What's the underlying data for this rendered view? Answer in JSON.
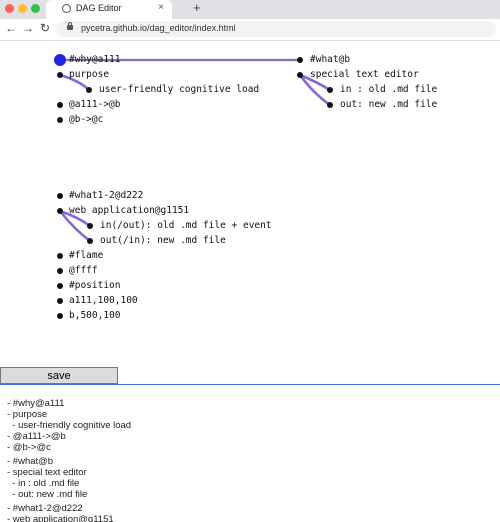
{
  "browser": {
    "tab_title": "DAG Editor",
    "tab_close": "×",
    "new_tab": "+",
    "back": "←",
    "forward": "→",
    "reload": "↻",
    "url": "pycetra.github.io/dag_editor/index.html",
    "traffic_lights": [
      "#ff5f57",
      "#febc2e",
      "#28c840"
    ]
  },
  "graph": {
    "nodes": [
      {
        "text": "#why@a111"
      },
      {
        "text": "purpose"
      },
      {
        "text": "user-friendly cognitive load"
      },
      {
        "text": "@a111->@b"
      },
      {
        "text": "@b->@c"
      },
      {
        "text": "#what@b"
      },
      {
        "text": "special text editor"
      },
      {
        "text": "in : old .md file"
      },
      {
        "text": "out: new .md file"
      },
      {
        "text": "#what1-2@d222"
      },
      {
        "text": "web application@g1151"
      },
      {
        "text": "in(/out): old .md file + event"
      },
      {
        "text": "out(/in): new .md file"
      },
      {
        "text": "#flame"
      },
      {
        "text": "@ffff"
      },
      {
        "text": "#position"
      },
      {
        "text": "a111,100,100"
      },
      {
        "text": "b,500,100"
      }
    ],
    "colors": {
      "selected": "#2222ee",
      "edge": "#8a63e8",
      "link": "#555555"
    }
  },
  "toolbar": {
    "save_label": "save"
  },
  "editor": {
    "lines": [
      "- #why@a111",
      "- purpose",
      "  - user-friendly cognitive load",
      "- @a111->@b",
      "- @b->@c",
      "",
      "- #what@b",
      "- special text editor",
      "  - in : old .md file",
      "  - out: new .md file",
      "",
      "- #what1-2@d222",
      "- web application@g1151"
    ]
  }
}
